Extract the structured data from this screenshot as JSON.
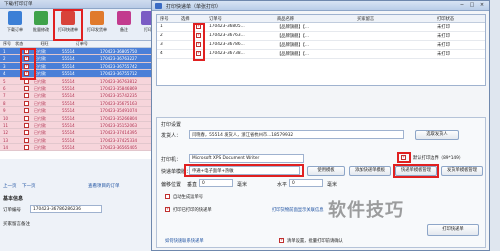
{
  "bg_app": {
    "title": "下载/打印订单",
    "toolbar": [
      {
        "label": "下载订单"
      },
      {
        "label": "批量修改"
      },
      {
        "label": "打印快递单"
      },
      {
        "label": "打印发货单"
      },
      {
        "label": "备注"
      },
      {
        "label": "打印"
      }
    ],
    "grid_header": [
      "序号",
      "状态",
      "旺旺",
      "订单号"
    ],
    "grid_rows": [
      {
        "no": "1",
        "status": "已付款",
        "code": "55514",
        "order": "170423-36805750"
      },
      {
        "no": "2",
        "status": "已付款",
        "code": "55514",
        "order": "170423-36763227"
      },
      {
        "no": "3",
        "status": "已付款",
        "code": "55514",
        "order": "170423-36755742"
      },
      {
        "no": "4",
        "status": "已付款",
        "code": "55514",
        "order": "170423-36755712"
      },
      {
        "no": "5",
        "status": "已付款",
        "code": "55514",
        "order": "170423-36763812"
      },
      {
        "no": "6",
        "status": "已付款",
        "code": "55514",
        "order": "170423-35846869"
      },
      {
        "no": "7",
        "status": "已付款",
        "code": "55514",
        "order": "170423-35742235"
      },
      {
        "no": "8",
        "status": "已付款",
        "code": "55514",
        "order": "170423-35675163"
      },
      {
        "no": "9",
        "status": "已付款",
        "code": "55514",
        "order": "170423-35491074"
      },
      {
        "no": "10",
        "status": "已付款",
        "code": "55514",
        "order": "170423-35266804"
      },
      {
        "no": "11",
        "status": "已付款",
        "code": "55514",
        "order": "170423-35152063"
      },
      {
        "no": "12",
        "status": "已付款",
        "code": "55514",
        "order": "170423-37414395"
      },
      {
        "no": "13",
        "status": "已付款",
        "code": "55514",
        "order": "170423-37425334"
      },
      {
        "no": "14",
        "status": "已付款",
        "code": "55514",
        "order": "170423-36565405"
      }
    ],
    "pager": {
      "prev": "上一页",
      "next": "下一页",
      "info": "查看项目的订单"
    },
    "detail": {
      "tab": "基本信息",
      "order_label": "订单编号",
      "order_value": "170423-36786286236",
      "buyer_label": "买家留言备注"
    }
  },
  "dialog": {
    "title": "打印快递单（单张打印）",
    "table_header": [
      "序号",
      "选择",
      "订单号",
      "商品名称",
      "买家留言",
      "打印状态"
    ],
    "rows": [
      {
        "no": "1",
        "checked": true,
        "order": "170423-36805...",
        "product": "【品牌旗舰】【...",
        "status": "未打印"
      },
      {
        "no": "2",
        "checked": true,
        "order": "170423-36763...",
        "product": "【品牌旗舰】【...",
        "status": "未打印"
      },
      {
        "no": "3",
        "checked": true,
        "order": "170423-36786...",
        "product": "【品牌旗舰】【...",
        "status": "未打印"
      },
      {
        "no": "4",
        "checked": true,
        "order": "170423-36738...",
        "product": "【品牌旗舰】【...",
        "status": "未打印"
      }
    ],
    "print_settings": {
      "section": "打印设置",
      "sender_label": "发货人：",
      "sender_value": "闫晓春，55514 发货人，浙江省杭州市...18579932",
      "select_sender": "选取发货人",
      "printer_label": "打印机：",
      "printer_value": "Microsoft XPS Document Writer",
      "use_page_setting": "默认打印边界（89*149）",
      "template_label": "快递单模版：",
      "template_value": "申通+电子面单+热敏",
      "btn_use": "使用模板",
      "btn_add": "添加快递单模板",
      "btn_manage": "快递单模板管理",
      "btn_print_mgr": "发货单模板管理",
      "offset_label": "偏移位置",
      "offset_vertical": "垂直",
      "offset_v_value": "0",
      "offset_horizontal": "水平",
      "offset_h_value": "0",
      "offset_unit": "毫米",
      "opt1": "自动生成运单号",
      "opt2": "打印已打印的快递单",
      "opt3": "打印货物前面显示关联信息",
      "link_hint": "如何快速联系快递单",
      "link_setting": "清单设置，批量打印前请确认",
      "btn_print": "打印快递单"
    }
  },
  "watermark": "软件技巧"
}
